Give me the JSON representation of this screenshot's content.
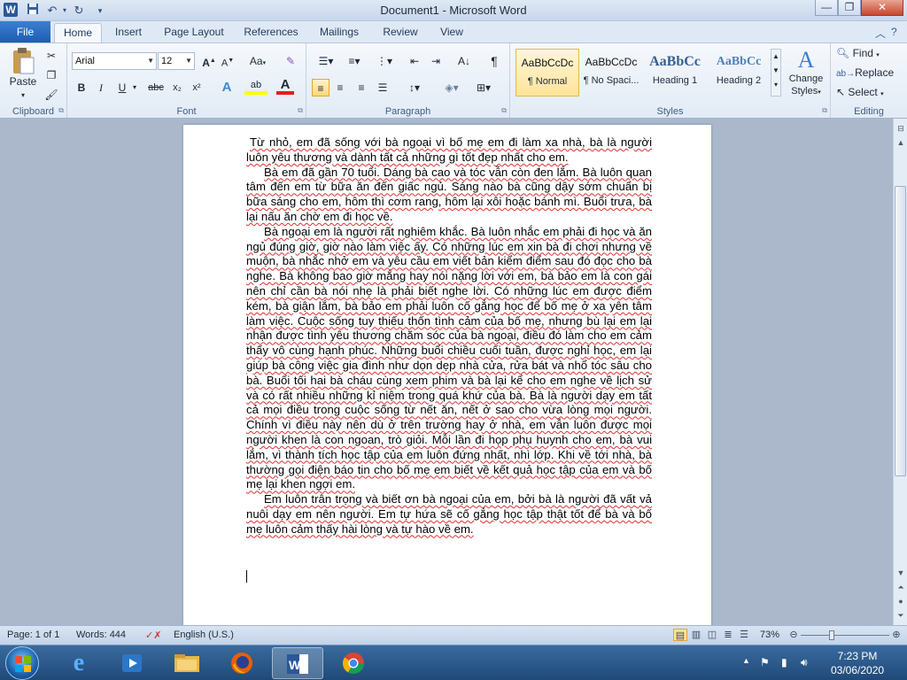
{
  "window": {
    "title": "Document1  -  Microsoft Word",
    "app_icon": "W",
    "qat": {
      "save_icon": "save-icon",
      "undo_icon": "undo-icon",
      "redo_icon": "redo-icon",
      "customize_icon": "customize-qat-icon"
    },
    "controls": {
      "minimize": "—",
      "restore": "❐",
      "close": "✕"
    }
  },
  "tabs": {
    "file": "File",
    "items": [
      "Home",
      "Insert",
      "Page Layout",
      "References",
      "Mailings",
      "Review",
      "View"
    ],
    "active": "Home"
  },
  "ribbon": {
    "clipboard": {
      "label": "Clipboard",
      "paste": "Paste"
    },
    "font": {
      "label": "Font",
      "font_name": "Arial",
      "font_size": "12",
      "grow": "A",
      "shrink": "A",
      "case": "Aa",
      "bold": "B",
      "italic": "I",
      "underline": "U",
      "strike": "abc",
      "subscript": "x₂",
      "superscript": "x²",
      "text_effects": "A",
      "highlight": "ab",
      "font_color": "A"
    },
    "paragraph": {
      "label": "Paragraph",
      "pilcrow": "¶"
    },
    "styles": {
      "label": "Styles",
      "items": [
        {
          "sample": "AaBbCcDc",
          "name": "¶ Normal"
        },
        {
          "sample": "AaBbCcDc",
          "name": "¶ No Spaci..."
        },
        {
          "sample": "AaBbCc",
          "name": "Heading 1"
        },
        {
          "sample": "AaBbCc",
          "name": "Heading 2"
        }
      ],
      "change_styles_1": "Change",
      "change_styles_2": "Styles"
    },
    "editing": {
      "label": "Editing",
      "find": "Find",
      "replace": "Replace",
      "select": "Select"
    }
  },
  "document": {
    "paragraphs": [
      "Từ nhỏ, em đã sống với bà ngoại vì bố mẹ em đi làm xa nhà, bà là người luôn yêu thương và dành tất cả những gì tốt đẹp nhất cho em.",
      "Bà em đã gần 70 tuổi. Dáng bà cao và tóc vẫn còn đen lắm. Bà luôn quan tâm đến em từ bữa ăn đến giấc ngủ. Sáng nào bà cũng dậy sớm chuẩn bị bữa sáng cho em, hôm thì cơm rang, hôm lại xôi hoặc bánh mì. Buổi trưa, bà lại nấu ăn chờ em đi học về.",
      "Bà ngoại em là người rất nghiêm khắc. Bà luôn nhắc em phải đi học và ăn ngủ đúng giờ, giờ nào làm việc ấy. Có những lúc em xin bà đi chơi nhưng về muộn, bà nhắc nhở em và yêu cầu em viết bản kiểm điểm sau đó đọc cho bà nghe. Bà không bao giờ mắng hay nói nặng lời với em, bà bảo em là con gái nên chỉ cần bà nói nhẹ là phải biết nghe lời. Có những lúc em được điểm kém, bà giận lắm, bà bảo em phải luôn cố gắng học để bố mẹ ở xa yên tâm làm việc. Cuộc sống tuy thiếu thốn tình cảm của bố mẹ, nhưng bù lại em lại nhận được tình yêu thương chăm sóc của bà ngoại, điều đó làm cho em cảm thấy vô cùng hạnh phúc. Những buổi chiều cuối tuần, được nghỉ học, em lại giúp bà công việc gia đình như dọn dẹp nhà cửa, rửa bát và nhổ tóc sâu cho bà. Buổi tối hai bà cháu cùng xem phim và bà lại kể cho em nghe về lịch sử và có rất nhiều những kỉ niệm trong quá khứ của bà. Bà là người dạy em tất cả mọi điều trong cuộc sống từ nết ăn, nết ở sao cho vừa lòng mọi người. Chính vì điều này nên dù ở trên trường hay ở nhà, em vẫn luôn được mọi người khen là con ngoan, trò giỏi. Mỗi lần đi họp phụ huynh cho em, bà vui lắm, vì thành tích học tập của em luôn đứng nhất, nhì lớp. Khi về tới nhà, bà thường gọi điện báo tin cho bố mẹ em biết về kết quả học tập của em và bố mẹ lại khen ngợi em.",
      "Em luôn trân trọng và biết ơn bà ngoại của em, bởi bà là người đã vất vả nuôi dạy em nên người. Em tự hứa sẽ cố gắng học tập thật tốt để bà và bố mẹ luôn cảm thấy hài lòng và tự hào về em."
    ]
  },
  "status": {
    "page": "Page: 1 of 1",
    "words": "Words: 444",
    "language": "English (U.S.)",
    "zoom": "73%",
    "zoom_level": 0.73
  },
  "taskbar": {
    "time": "7:23 PM",
    "date": "03/06/2020"
  }
}
